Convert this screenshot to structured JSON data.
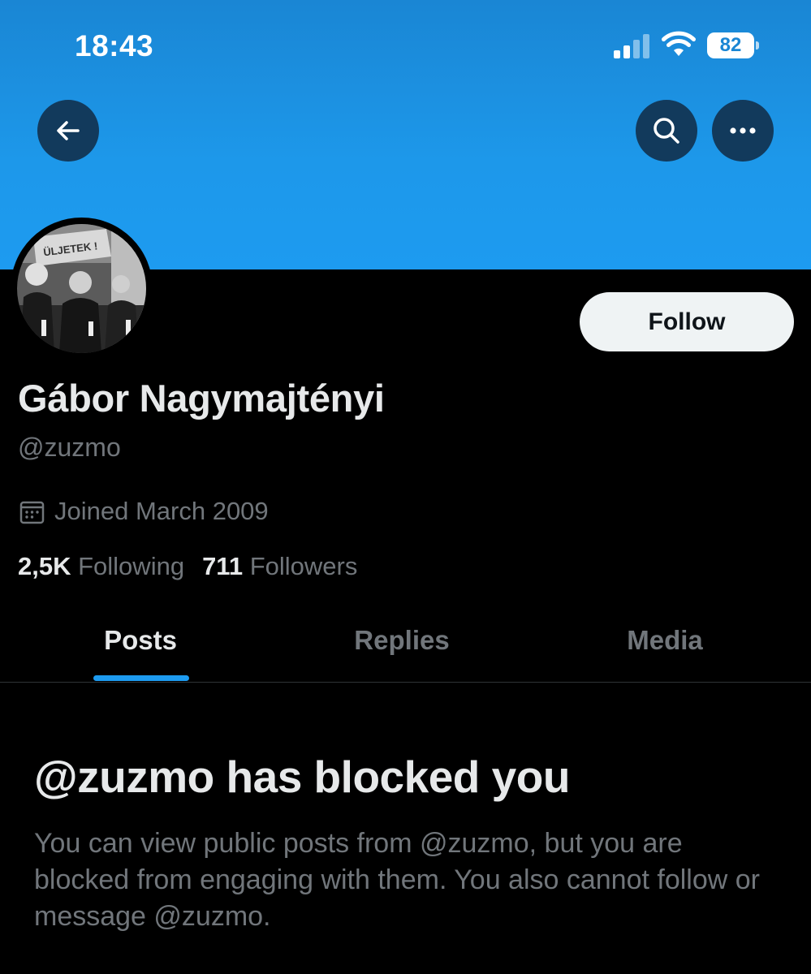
{
  "status_bar": {
    "time": "18:43",
    "battery": "82"
  },
  "header": {
    "banner_color": "#1d9bf0",
    "back_icon": "arrow-left-icon",
    "search_icon": "search-icon",
    "more_icon": "more-horizontal-icon"
  },
  "profile": {
    "display_name": "Gábor Nagymajtényi",
    "handle": "@zuzmo",
    "avatar_banner_text": "ÜLJETEK !",
    "follow_label": "Follow",
    "joined": "Joined March 2009",
    "following_count": "2,5K",
    "following_label": "Following",
    "followers_count": "711",
    "followers_label": "Followers"
  },
  "tabs": [
    {
      "label": "Posts",
      "active": true
    },
    {
      "label": "Replies",
      "active": false
    },
    {
      "label": "Media",
      "active": false
    }
  ],
  "blocked": {
    "title": "@zuzmo has blocked you",
    "message": "You can view public posts from @zuzmo, but you are blocked from engaging with them. You also cannot follow or message @zuzmo."
  },
  "colors": {
    "accent": "#1d9bf0",
    "muted_text": "#71767b",
    "primary_text": "#e7e9ea"
  }
}
